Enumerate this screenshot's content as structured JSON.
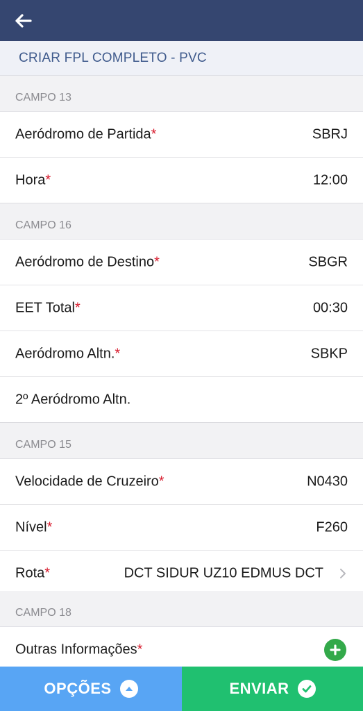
{
  "colors": {
    "header_bg": "#354670",
    "title_text": "#3f5a8c",
    "required": "#d7192b",
    "options_button": "#58a5f4",
    "send_button": "#20c070",
    "add_icon": "#33a94a"
  },
  "header": {
    "back_icon": "arrow-left-icon"
  },
  "title": "CRIAR FPL COMPLETO - PVC",
  "sections": {
    "campo13": {
      "header": "CAMPO 13",
      "departure": {
        "label": "Aeródromo de Partida",
        "required": "*",
        "value": "SBRJ"
      },
      "time": {
        "label": "Hora",
        "required": "*",
        "value": "12:00"
      }
    },
    "campo16": {
      "header": "CAMPO 16",
      "destination": {
        "label": "Aeródromo de Destino",
        "required": "*",
        "value": "SBGR"
      },
      "eet": {
        "label": "EET Total",
        "required": "*",
        "value": "00:30"
      },
      "alternate": {
        "label": "Aeródromo Altn.",
        "required": "*",
        "value": "SBKP"
      },
      "alternate2": {
        "label": "2º Aeródromo Altn.",
        "value": ""
      }
    },
    "campo15": {
      "header": "CAMPO 15",
      "speed": {
        "label": "Velocidade de Cruzeiro",
        "required": "*",
        "value": "N0430"
      },
      "level": {
        "label": "Nível",
        "required": "*",
        "value": "F260"
      },
      "route": {
        "label": "Rota",
        "required": "*",
        "value": "DCT SIDUR UZ10 EDMUS DCT",
        "icon": "chevron-right-icon"
      }
    },
    "campo18": {
      "header": "CAMPO 18",
      "other_info": {
        "label": "Outras Informações",
        "required": "*",
        "icon": "plus-circle-icon"
      }
    }
  },
  "bottom_bar": {
    "options_label": "OPÇÕES",
    "options_icon": "chevron-up-circle-icon",
    "send_label": "ENVIAR",
    "send_icon": "check-circle-icon"
  }
}
